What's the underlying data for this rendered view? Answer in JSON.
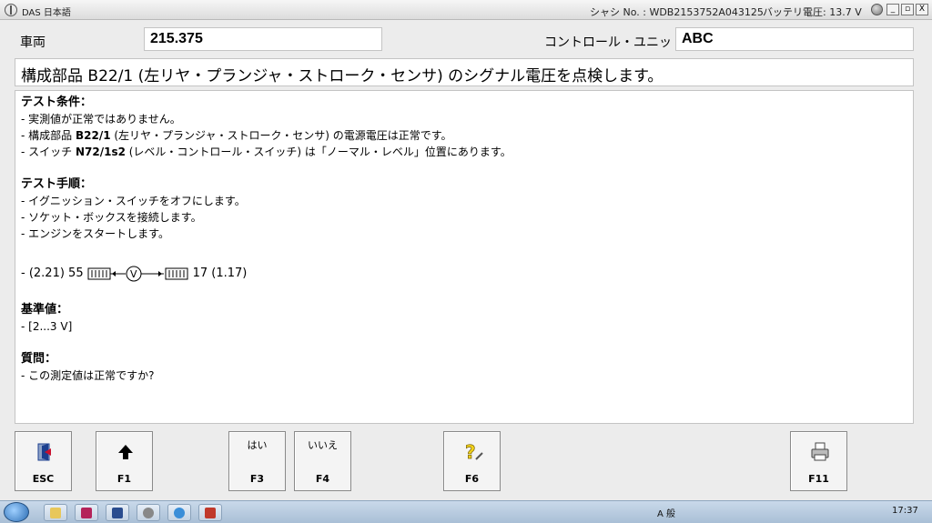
{
  "window": {
    "title": "DAS 日本語",
    "chassis": "シャシ No. : WDB2153752A043125",
    "battery": "バッテリ電圧: 13.7 V",
    "min_label": "_",
    "restore_label": "▫",
    "close_label": "X"
  },
  "header": {
    "vehicle_label": "車両",
    "vehicle_value": "215.375",
    "control_unit_label": "コントロール・ユニット",
    "control_unit_value": "ABC"
  },
  "headline": "構成部品 B22/1 (左リヤ・プランジャ・ストローク・センサ) のシグナル電圧を点検します。",
  "content": {
    "test_conditions_title": "テスト条件：",
    "cond1": "- 実測値が正常ではありません。",
    "cond2_pre": "- 構成部品 ",
    "cond2_code": "B22/1",
    "cond2_post": " (左リヤ・プランジャ・ストローク・センサ) の電源電圧は正常です。",
    "cond3_pre": "- スイッチ ",
    "cond3_code": "N72/1s2",
    "cond3_post": " (レベル・コントロール・スイッチ) は「ノーマル・レベル」位置にあります。",
    "procedure_title": "テスト手順：",
    "step1": "- イグニッション・スイッチをオフにします。",
    "step2": "- ソケット・ボックスを接続します。",
    "step3": "- エンジンをスタートします。",
    "circuit_left": "- (2.21) 55",
    "circuit_right": "17 (1.17)",
    "reference_title": "基準値：",
    "reference_value": "- [2...3 V]",
    "question_title": "質問：",
    "question_text": "- この測定値は正常ですか?"
  },
  "fkeys": [
    {
      "label": "ESC",
      "top": "",
      "icon": "exit-icon"
    },
    {
      "label": "F1",
      "top": "",
      "icon": "arrow-up-icon"
    },
    {
      "label": "F3",
      "top": "はい",
      "icon": ""
    },
    {
      "label": "F4",
      "top": "いいえ",
      "icon": ""
    },
    {
      "label": "F6",
      "top": "",
      "icon": "help-icon"
    },
    {
      "label": "F11",
      "top": "",
      "icon": "printer-icon"
    }
  ],
  "taskbar": {
    "clock": "17:37",
    "ime": "A 般"
  },
  "colors": {
    "help_yellow": "#f2d21b",
    "exit_red": "#c8102e",
    "exit_blue": "#1c3f8f"
  }
}
